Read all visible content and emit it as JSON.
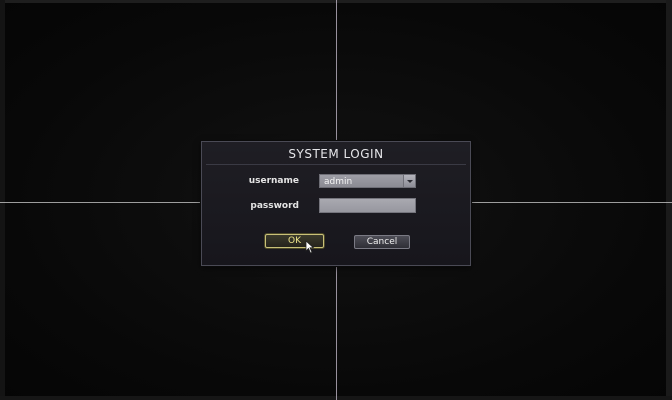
{
  "dialog": {
    "title": "SYSTEM LOGIN",
    "username_label": "username",
    "username_value": "admin",
    "password_label": "password",
    "password_value": "",
    "ok_label": "OK",
    "cancel_label": "Cancel"
  },
  "icons": {
    "dropdown": "chevron-down-icon",
    "pointer": "mouse-cursor-icon"
  },
  "colors": {
    "background": "#0b0b0b",
    "dialog_bg": "#1b1a20",
    "ok_accent": "#c9c178",
    "split_lines": "#cfcfcf"
  }
}
